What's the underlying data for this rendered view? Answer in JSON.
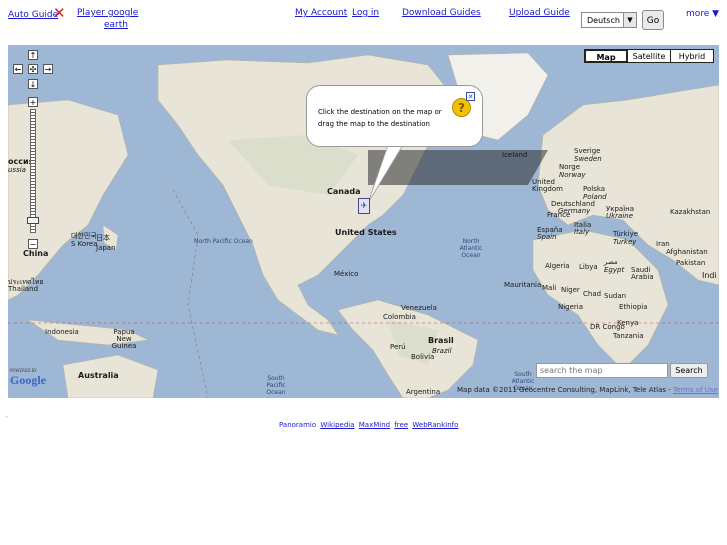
{
  "nav": {
    "auto_guide": "Auto Guide",
    "player_google_earth_line1": "Player google",
    "player_google_earth_line2": "earth",
    "my_account": "My Account",
    "log_in": "Log in",
    "download_guides": "Download Guides",
    "upload_guide": "Upload Guide",
    "language_selected": "Deutsch",
    "go_button": "Go",
    "more": "more ▼"
  },
  "map": {
    "type_buttons": [
      "Map",
      "Satellite",
      "Hybrid"
    ],
    "selected_type": "Map",
    "popup_message": "Click the destination on the map or drag the map to the destination",
    "search_placeholder": "search the map",
    "search_button": "Search",
    "attribution": "Map data ©2011 Geocentre Consulting, MapLink, Tele Atlas -",
    "terms_link": "Terms of Use",
    "logo_powered_by": "POWERED BY",
    "logo_text": "Google",
    "labels": {
      "canada": "Canada",
      "united_states": "United States",
      "mexico": "México",
      "venezuela": "Venezuela",
      "colombia": "Colombia",
      "peru": "Perú",
      "bolivia": "Bolivia",
      "brasil": "Brasil",
      "brazil": "Brazil",
      "argentina": "Argentina",
      "north_pacific_ocean": "North Pacific Ocean",
      "north_atlantic_ocean": "North Atlantic Ocean",
      "south_pacific_ocean": "South Pacific Ocean",
      "south_atlantic_ocean": "South Atlantic Ocean",
      "iceland": "Iceland",
      "sverige": "Sverige",
      "sweden": "Sweden",
      "norge": "Norge",
      "norway": "Norway",
      "united_kingdom": "United Kingdom",
      "polska": "Polska",
      "poland": "Poland",
      "france": "France",
      "deutschland": "Deutschland",
      "germany": "Germany",
      "espana": "España",
      "spain": "Spain",
      "italia": "Italia",
      "italy": "Italy",
      "ukraina": "Україна",
      "ukraine": "Ukraine",
      "turkiye": "Türkiye",
      "turkey": "Turkey",
      "kazakhstan": "Kazakhstan",
      "iran": "Iran",
      "afghanistan": "Afghanistan",
      "pakistan": "Pakistan",
      "india": "Indi",
      "algeria": "Algeria",
      "libya": "Libya",
      "egypt_ar": "مصر",
      "egypt": "Egypt",
      "saudi_arabia": "Saudi Arabia",
      "mauritania": "Mauritania",
      "mali": "Mali",
      "niger": "Niger",
      "chad": "Chad",
      "sudan": "Sudan",
      "ethiopia": "Ethiopia",
      "nigeria": "Nigeria",
      "dr_congo": "DR Congo",
      "kenya": "Kenya",
      "tanzania": "Tanzania",
      "japan_jp": "日本",
      "japan": "Japan",
      "south_korea_kr": "대한민국",
      "south_korea": "S Korea",
      "china": "China",
      "russia_ru": "оссия",
      "russia": "ussia",
      "thailand_th": "ประเทศไทย",
      "thailand": "Thailand",
      "indonesia": "Indonesia",
      "papua_new_guinea": "Papua New Guinea",
      "australia": "Australia"
    }
  },
  "footer": {
    "links": [
      "Panoramio",
      "Wikipedia",
      "MaxMind",
      "free",
      "WebRankInfo"
    ]
  },
  "colors": {
    "link": "#1a1ad0",
    "ocean": "#9eb7d4",
    "land": "#e8e4d8",
    "red_x": "#d21f1f"
  }
}
